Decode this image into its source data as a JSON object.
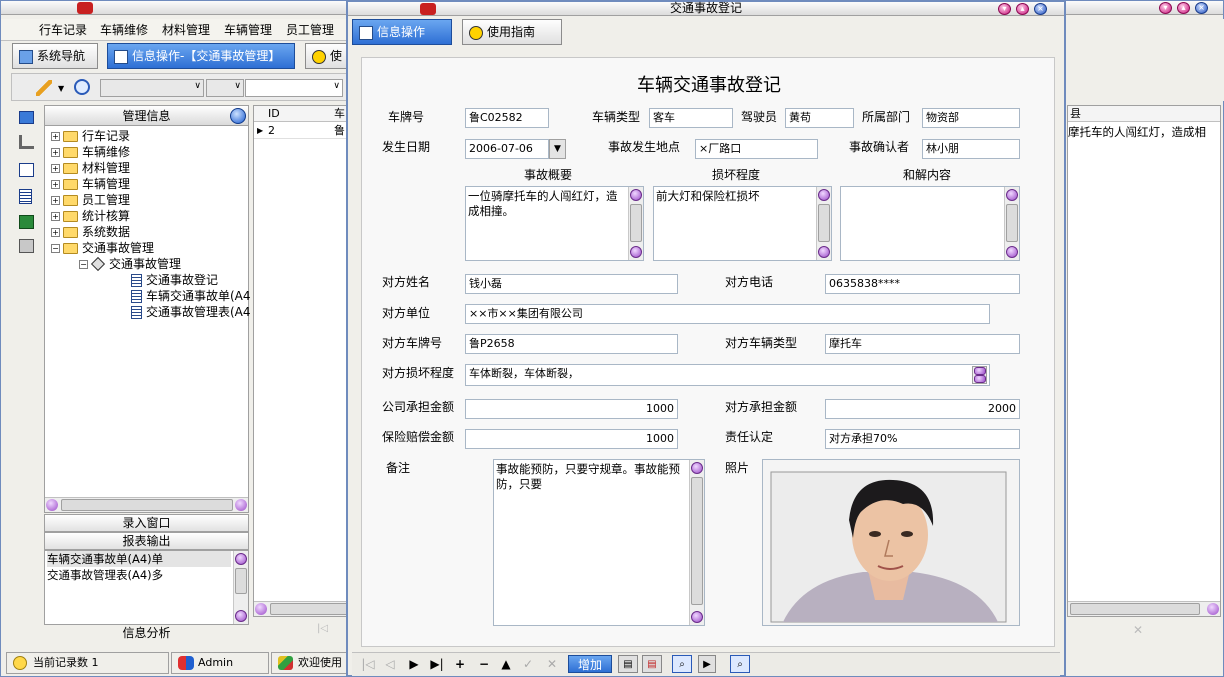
{
  "main_window": {
    "menu": [
      "行车记录",
      "车辆维修",
      "材料管理",
      "车辆管理",
      "员工管理"
    ],
    "nav_tab": "系统导航",
    "info_tab": "信息操作-【交通事故管理】",
    "help_tab_partial": "使",
    "tree_header": "管理信息",
    "tree": {
      "roots": [
        "行车记录",
        "车辆维修",
        "材料管理",
        "车辆管理",
        "员工管理",
        "统计核算",
        "系统数据",
        "交通事故管理"
      ],
      "child": "交通事故管理",
      "leaves": [
        "交通事故登记",
        "车辆交通事故单(A4",
        "交通事故管理表(A4"
      ]
    },
    "panel_sections": [
      "录入窗口",
      "报表输出",
      "信息分析"
    ],
    "report_list": [
      "车辆交通事故单(A4)单",
      "交通事故管理表(A4)多"
    ],
    "grid": {
      "headers": [
        "ID",
        "车"
      ],
      "rows": [
        [
          "2",
          "鲁"
        ]
      ]
    },
    "status": {
      "record_count": "当前记录数 1",
      "user": "Admin",
      "welcome": "欢迎使用"
    }
  },
  "right_window": {
    "header_partial": "县",
    "row_text": "摩托车的人闯红灯，造成相"
  },
  "dialog": {
    "title": "交通事故登记",
    "tabs": {
      "info": "信息操作",
      "guide": "使用指南"
    },
    "form_title": "车辆交通事故登记",
    "labels": {
      "plate": "车牌号",
      "vehicle_type": "车辆类型",
      "driver": "驾驶员",
      "department": "所属部门",
      "date": "发生日期",
      "location": "事故发生地点",
      "confirmer": "事故确认者",
      "summary": "事故概要",
      "damage": "损坏程度",
      "settlement": "和解内容",
      "other_name": "对方姓名",
      "other_phone": "对方电话",
      "other_unit": "对方单位",
      "other_plate": "对方车牌号",
      "other_type": "对方车辆类型",
      "other_damage": "对方损坏程度",
      "company_amount": "公司承担金额",
      "other_amount": "对方承担金额",
      "insurance_amount": "保险赔偿金额",
      "liability": "责任认定",
      "remark": "备注",
      "photo": "照片"
    },
    "values": {
      "plate": "鲁C02582",
      "vehicle_type": "客车",
      "driver": "黄苟",
      "department": "物资部",
      "date": "2006-07-06",
      "location": "×厂路口",
      "confirmer": "林小朋",
      "summary": "一位骑摩托车的人闯红灯，造成相撞。",
      "damage": "前大灯和保险杠损坏",
      "settlement": "",
      "other_name": "钱小磊",
      "other_phone": "0635838****",
      "other_unit": "××市××集团有限公司",
      "other_plate": "鲁P2658",
      "other_type": "摩托车",
      "other_damage": "车体断裂，车体断裂，",
      "company_amount": "1000",
      "other_amount": "2000",
      "insurance_amount": "1000",
      "liability": "对方承担70%",
      "remark": "事故能预防，只要守规章。事故能预防，只要"
    },
    "toolbar": {
      "add": "增加"
    }
  },
  "colors": {
    "accent": "#2e6fd4",
    "window_border": "#6f8bbd",
    "title_btn": "#c8107a"
  }
}
